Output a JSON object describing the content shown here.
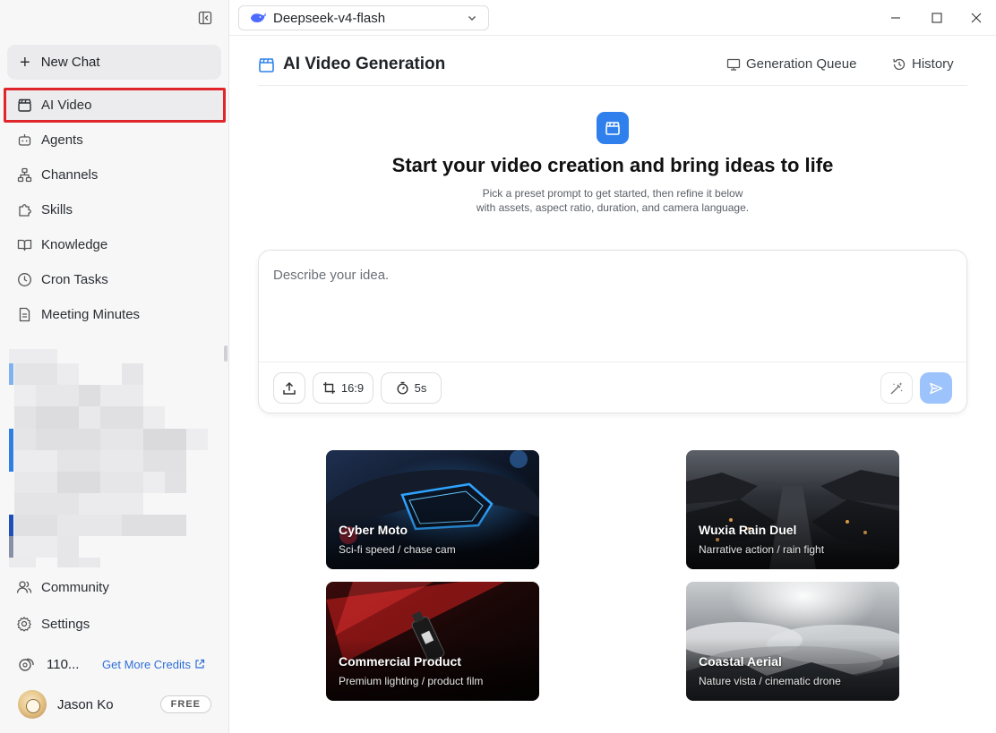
{
  "sidebar": {
    "new_chat": "New Chat",
    "items": [
      {
        "label": "AI Video",
        "icon": "clapperboard-icon"
      },
      {
        "label": "Agents",
        "icon": "bot-icon"
      },
      {
        "label": "Channels",
        "icon": "network-icon"
      },
      {
        "label": "Skills",
        "icon": "puzzle-icon"
      },
      {
        "label": "Knowledge",
        "icon": "book-icon"
      },
      {
        "label": "Cron Tasks",
        "icon": "clock-icon"
      },
      {
        "label": "Meeting Minutes",
        "icon": "document-icon"
      }
    ],
    "community": "Community",
    "settings": "Settings",
    "credits": "110...",
    "get_more_credits": "Get More Credits",
    "user_name": "Jason Ko",
    "plan_badge": "FREE"
  },
  "topbar": {
    "model": "Deepseek-v4-flash"
  },
  "header": {
    "title": "AI Video Generation",
    "queue": "Generation Queue",
    "history": "History"
  },
  "hero": {
    "title": "Start your video creation and bring ideas to life",
    "subtitle_line1": "Pick a preset prompt to get started, then refine it below",
    "subtitle_line2": "with assets, aspect ratio, duration, and camera language."
  },
  "composer": {
    "placeholder": "Describe your idea.",
    "aspect_ratio": "16:9",
    "duration": "5s"
  },
  "presets": [
    {
      "title": "Cyber Moto",
      "subtitle": "Sci-fi speed / chase cam"
    },
    {
      "title": "Wuxia Rain Duel",
      "subtitle": "Narrative action / rain fight"
    },
    {
      "title": "Commercial Product",
      "subtitle": "Premium lighting / product film"
    },
    {
      "title": "Coastal Aerial",
      "subtitle": "Nature vista / cinematic drone"
    }
  ],
  "colors": {
    "accent": "#2f80ed",
    "highlight": "#e0262a",
    "send_disabled": "#9cc3fb"
  }
}
